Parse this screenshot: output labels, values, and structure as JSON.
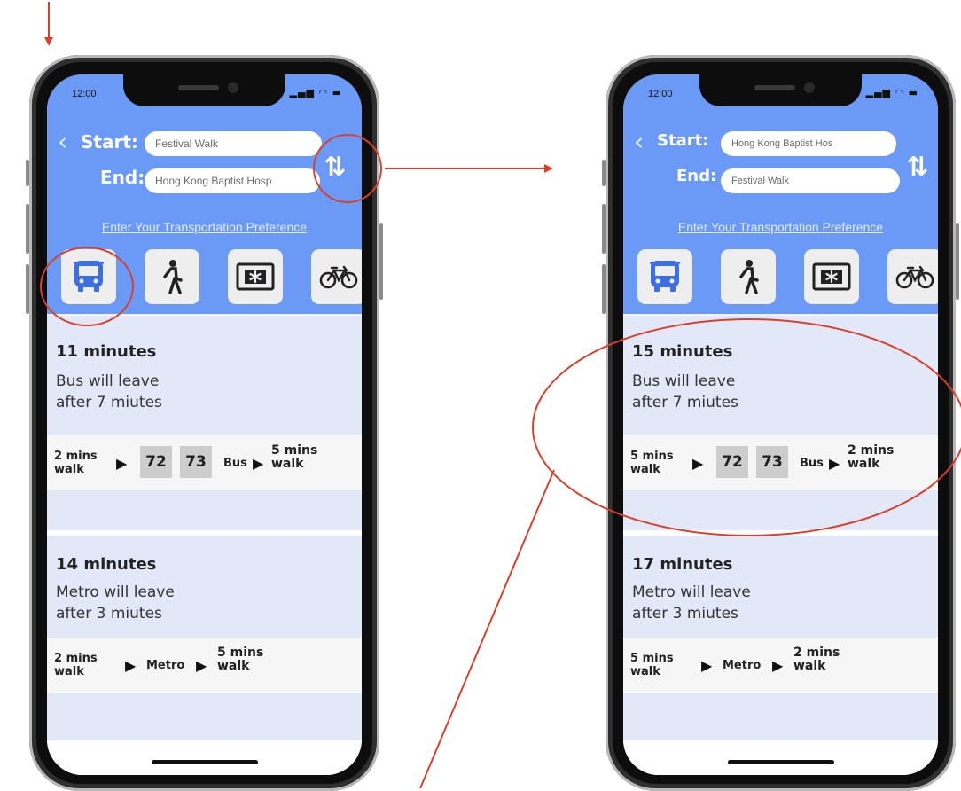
{
  "colors": {
    "header": "#6a9af5",
    "card": "#e2e8f8",
    "route_row": "#f6f6f6",
    "bus_number_bg": "#cdcdcd",
    "annotation": "#d9402b"
  },
  "screens": [
    {
      "status_time": "12:00",
      "start_label": "Start:",
      "start_value": "Festival Walk",
      "end_label": "End:",
      "end_value": "Hong Kong Baptist Hosp",
      "preference_link": "Enter Your Transportation Preference",
      "modes": [
        "bus-icon",
        "walk-icon",
        "metro-icon",
        "bike-icon"
      ],
      "results": [
        {
          "minutes": "11 minutes",
          "line1": "Bus will leave",
          "line2": "after 7 miutes",
          "walk1_a": "2 mins",
          "walk1_b": "walk",
          "bus1": "72",
          "bus2": "73",
          "mode_label": "Bus",
          "walk2_a": "5 mins",
          "walk2_b": "walk"
        },
        {
          "minutes": "14 minutes",
          "line1": "Metro will leave",
          "line2": "after 3 miutes",
          "walk1_a": "2 mins",
          "walk1_b": "walk",
          "mode_label": "Metro",
          "walk2_a": "5 mins",
          "walk2_b": "walk"
        }
      ]
    },
    {
      "status_time": "12:00",
      "start_label": "Start:",
      "start_value": "Hong Kong Baptist Hos",
      "end_label": "End:",
      "end_value": "Festival Walk",
      "preference_link": "Enter Your Transportation Preference",
      "modes": [
        "bus-icon",
        "walk-icon",
        "metro-icon",
        "bike-icon"
      ],
      "results": [
        {
          "minutes": "15 minutes",
          "line1": "Bus will leave",
          "line2": "after 7 miutes",
          "walk1_a": "5 mins",
          "walk1_b": "walk",
          "bus1": "72",
          "bus2": "73",
          "mode_label": "Bus",
          "walk2_a": "2 mins",
          "walk2_b": "walk"
        },
        {
          "minutes": "17 minutes",
          "line1": "Metro will leave",
          "line2": "after 3 miutes",
          "walk1_a": "5 mins",
          "walk1_b": "walk",
          "mode_label": "Metro",
          "walk2_a": "2 mins",
          "walk2_b": "walk"
        }
      ]
    }
  ]
}
